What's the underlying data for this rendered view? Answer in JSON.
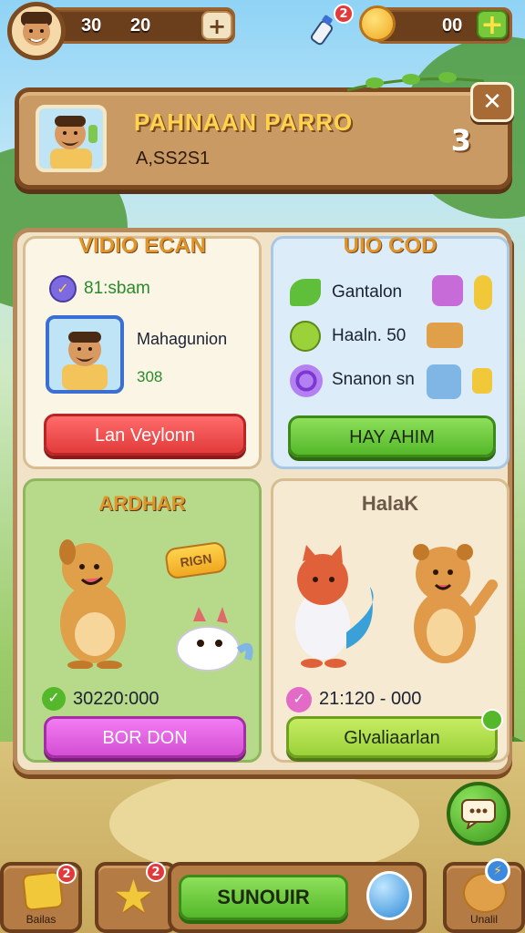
{
  "topbar": {
    "stat_a": "30",
    "stat_b": "20",
    "plus_label": "+",
    "gift_badge": "2",
    "coins": "00",
    "coin_plus_label": "+"
  },
  "profile": {
    "name": "PAHNAAN PARRO",
    "id": "A,SS2S1",
    "level": "3",
    "close_label": "✕"
  },
  "cards": {
    "video": {
      "title": "VIDIO ECAN",
      "row1": "81:sbam",
      "player_name": "Mahagunion",
      "player_score": "308",
      "button": "Lan Veylonn"
    },
    "info": {
      "title": "UIO COD",
      "rows": [
        "Gantalon",
        "Haaln. 50",
        "Snanon sn"
      ],
      "button": "HAY AHIM"
    },
    "ardhar": {
      "title": "ARDHAR",
      "tag": "RIGN",
      "value": "30220:000",
      "button": "BOR DON"
    },
    "halak": {
      "title": "HalaK",
      "value": "21:120 - 000",
      "button": "Glvaliaarlan"
    }
  },
  "bottombar": {
    "left_label": "Bailas",
    "left_badge": "2",
    "star_badge": "2",
    "main_button": "SUNOUIR",
    "right_label": "Unalil"
  },
  "colors": {
    "wood_dark": "#7b4a21",
    "panel": "#f1e3c8",
    "red_button": "#e23b3b",
    "green_button": "#54b82a",
    "pink_button": "#d44fd4",
    "gold_text": "#ffd34d"
  }
}
